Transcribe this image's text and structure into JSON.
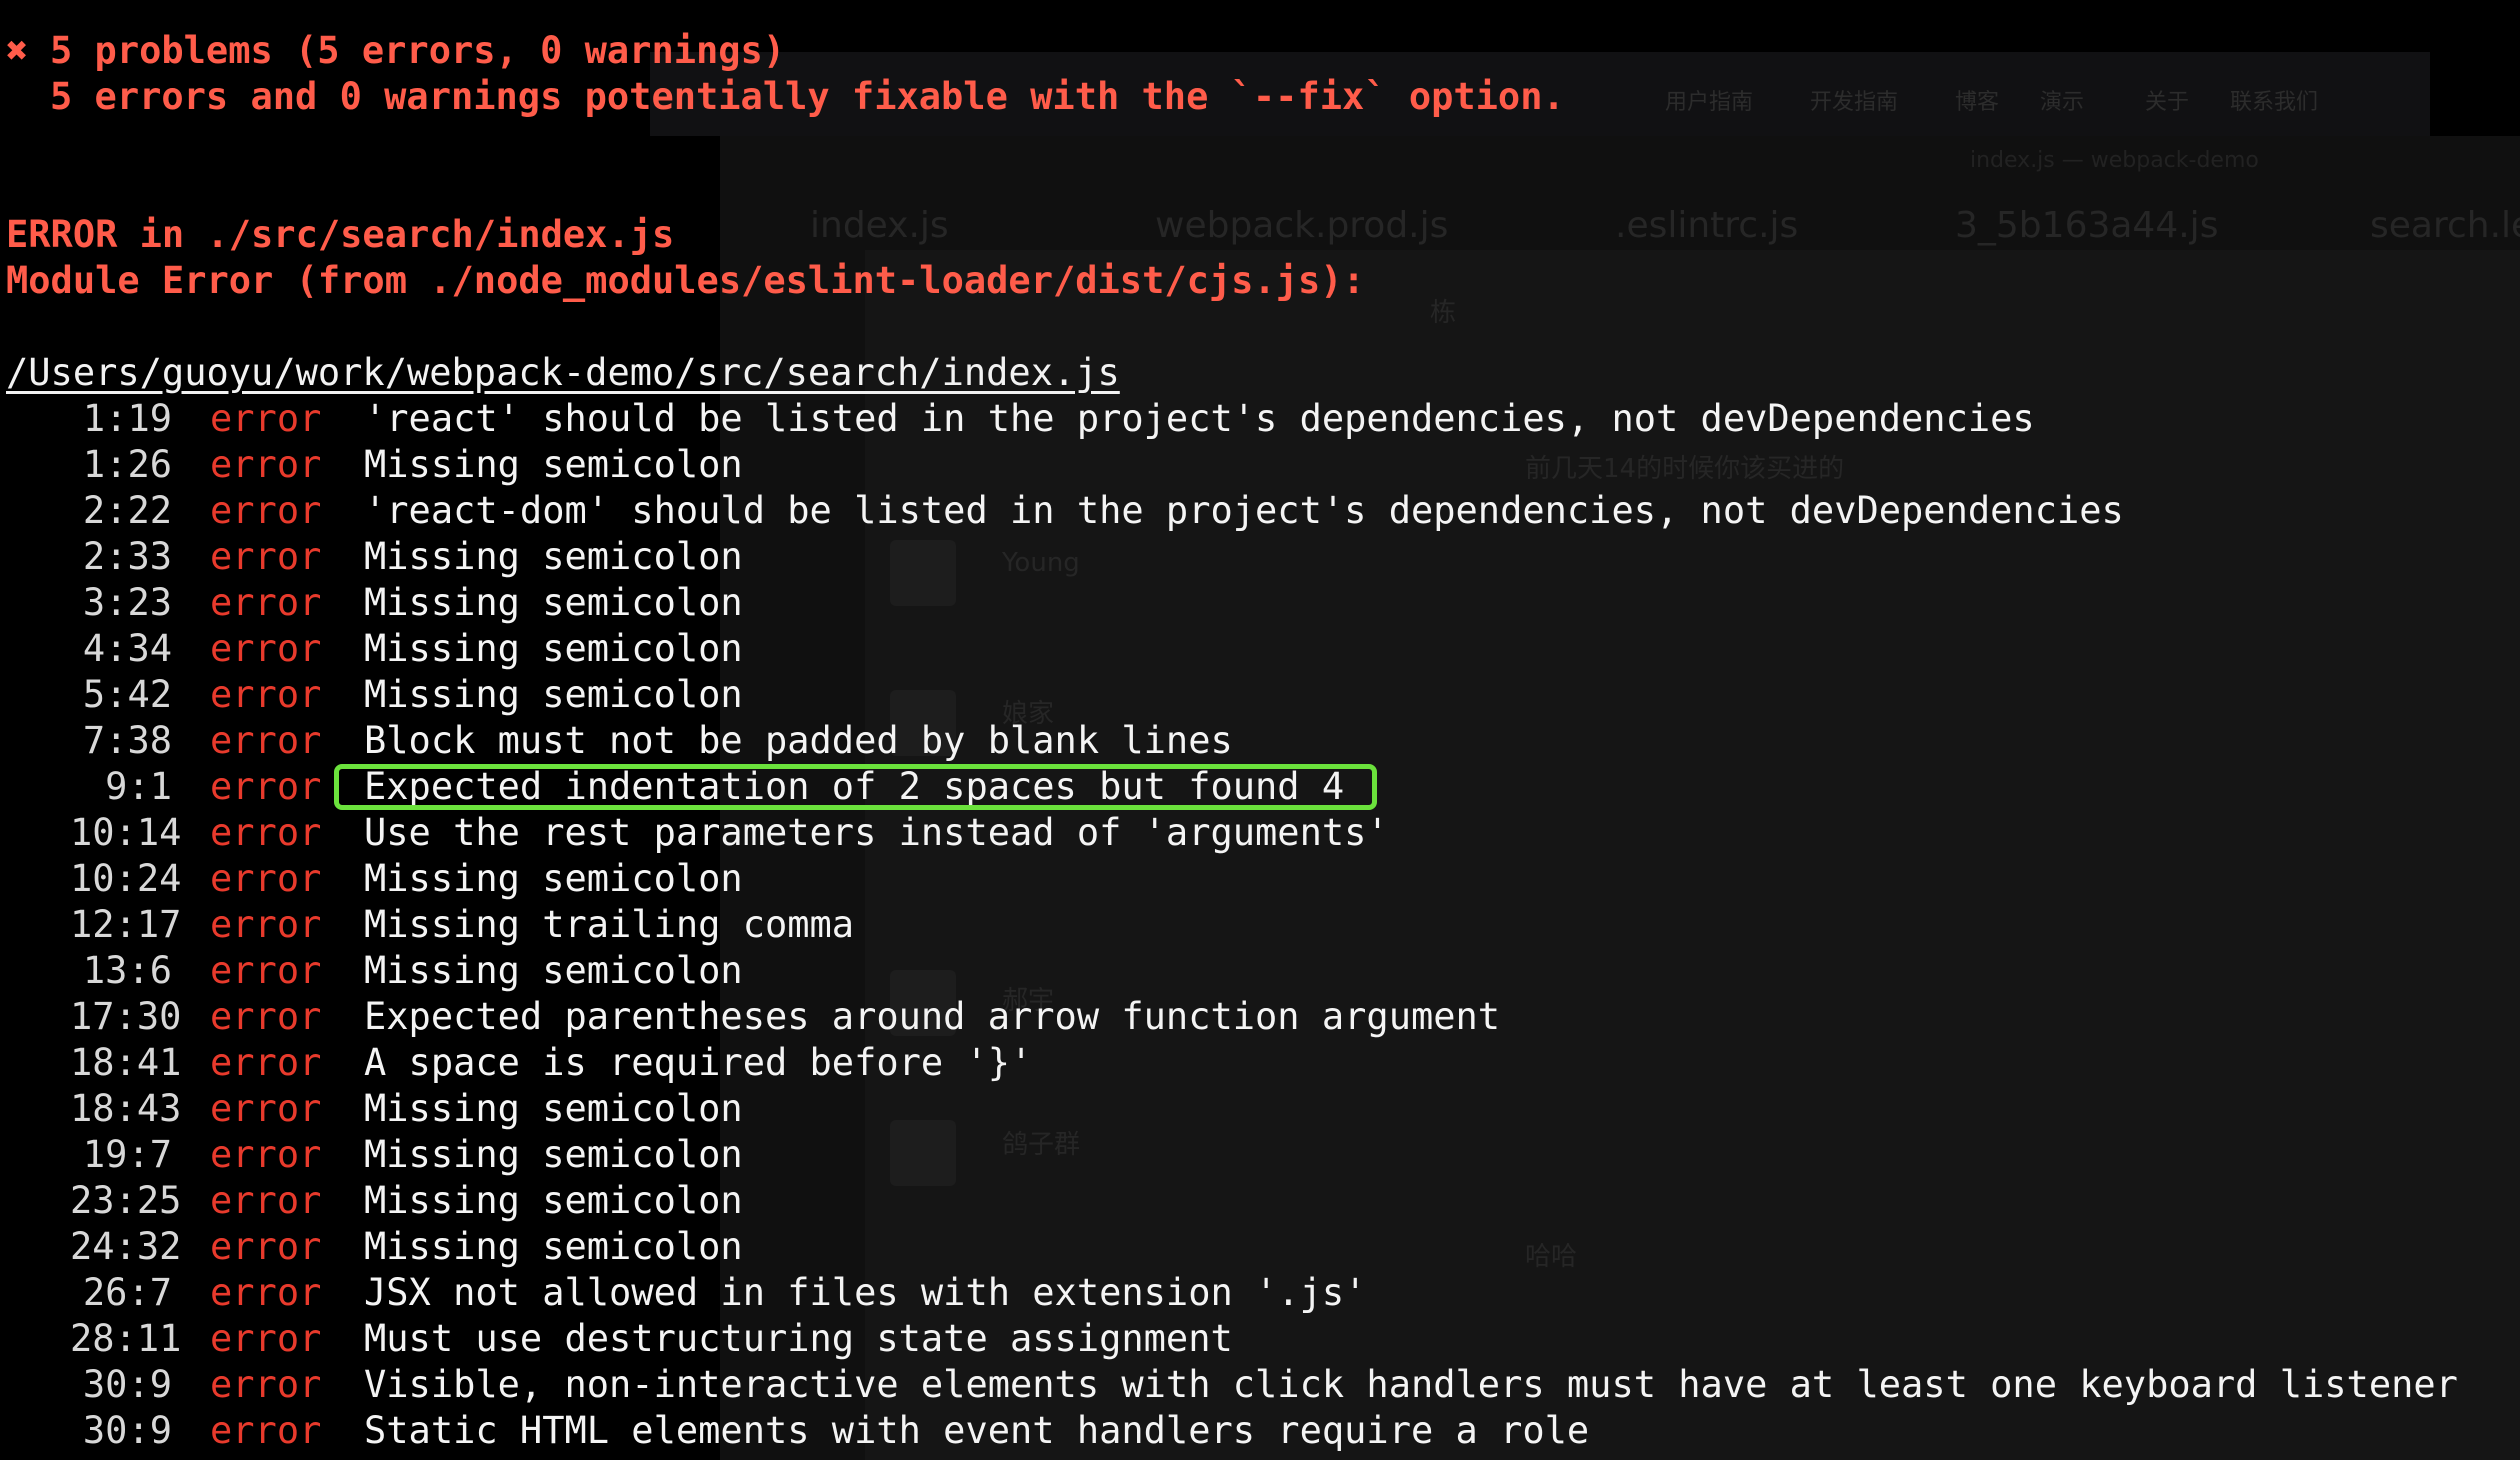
{
  "summary": {
    "icon": "error-x-icon",
    "problems_line": "5 problems (5 errors, 0 warnings)",
    "fixable_line": "5 errors and 0 warnings potentially fixable with the `--fix` option."
  },
  "error_block": {
    "error_in": "ERROR in ./src/search/index.js",
    "module_error": "Module Error (from ./node_modules/eslint-loader/dist/cjs.js):",
    "file_path": "/Users/guoyu/work/webpack-demo/src/search/index.js"
  },
  "lint_results": [
    {
      "loc": "1:19",
      "severity": "error",
      "message": "'react' should be listed in the project's dependencies, not devDependencies"
    },
    {
      "loc": "1:26",
      "severity": "error",
      "message": "Missing semicolon"
    },
    {
      "loc": "2:22",
      "severity": "error",
      "message": "'react-dom' should be listed in the project's dependencies, not devDependencies"
    },
    {
      "loc": "2:33",
      "severity": "error",
      "message": "Missing semicolon"
    },
    {
      "loc": "3:23",
      "severity": "error",
      "message": "Missing semicolon"
    },
    {
      "loc": "4:34",
      "severity": "error",
      "message": "Missing semicolon"
    },
    {
      "loc": "5:42",
      "severity": "error",
      "message": "Missing semicolon"
    },
    {
      "loc": "7:38",
      "severity": "error",
      "message": "Block must not be padded by blank lines"
    },
    {
      "loc": "9:1",
      "severity": "error",
      "message": "Expected indentation of 2 spaces but found 4"
    },
    {
      "loc": "10:14",
      "severity": "error",
      "message": "Use the rest parameters instead of 'arguments'"
    },
    {
      "loc": "10:24",
      "severity": "error",
      "message": "Missing semicolon"
    },
    {
      "loc": "12:17",
      "severity": "error",
      "message": "Missing trailing comma"
    },
    {
      "loc": "13:6",
      "severity": "error",
      "message": "Missing semicolon"
    },
    {
      "loc": "17:30",
      "severity": "error",
      "message": "Expected parentheses around arrow function argument"
    },
    {
      "loc": "18:41",
      "severity": "error",
      "message": "A space is required before '}'"
    },
    {
      "loc": "18:43",
      "severity": "error",
      "message": "Missing semicolon"
    },
    {
      "loc": "19:7",
      "severity": "error",
      "message": "Missing semicolon"
    },
    {
      "loc": "23:25",
      "severity": "error",
      "message": "Missing semicolon"
    },
    {
      "loc": "24:32",
      "severity": "error",
      "message": "Missing semicolon"
    },
    {
      "loc": "26:7",
      "severity": "error",
      "message": "JSX not allowed in files with extension '.js'"
    },
    {
      "loc": "28:11",
      "severity": "error",
      "message": "Must use destructuring state assignment"
    },
    {
      "loc": "30:9",
      "severity": "error",
      "message": "Visible, non-interactive elements with click handlers must have at least one keyboard listener"
    },
    {
      "loc": "30:9",
      "severity": "error",
      "message": "Static HTML elements with event handlers require a role"
    }
  ],
  "highlighted_result_index": 8,
  "background": {
    "nav_items": [
      "用户指南",
      "开发指南",
      "博客",
      "演示",
      "关于",
      "联系我们"
    ],
    "window_title": "index.js — webpack-demo",
    "editor_tabs": [
      "index.js",
      "webpack.prod.js",
      ".eslintrc.js",
      "3_5b163a44.js",
      "search.le"
    ],
    "chat_names": [
      "Young",
      "娘家",
      "郝宇",
      "鸽子群",
      "栋"
    ],
    "chat_messages": [
      "前几天14的时候你该买进的",
      "哈哈"
    ]
  },
  "colors": {
    "error_red": "#ff5c4a",
    "highlight_green": "#6be23c",
    "background": "#000000"
  }
}
